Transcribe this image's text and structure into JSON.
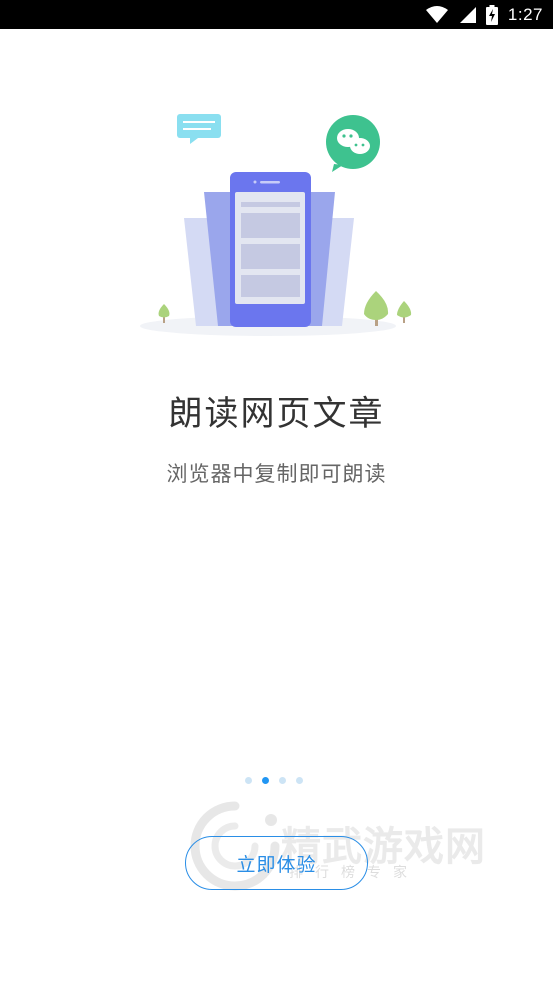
{
  "status_bar": {
    "time": "1:27",
    "icons": [
      "wifi-icon",
      "cell-signal-icon",
      "battery-charging-icon"
    ]
  },
  "onboarding": {
    "title": "朗读网页文章",
    "subtitle": "浏览器中复制即可朗读",
    "page_indicator": {
      "total": 4,
      "active_index": 1
    },
    "cta_label": "立即体验"
  },
  "illustration": {
    "icons": [
      "chat-bubble-icon",
      "wechat-icon",
      "phone-icon",
      "tree-icon"
    ]
  },
  "watermark": {
    "brand": "精武游戏网",
    "tagline": "排行榜专家"
  },
  "colors": {
    "accent": "#2a8ee6",
    "active_dot": "#2196f3",
    "inactive_dot": "#cde4f5",
    "phone": "#6b76ee",
    "wechat": "#3ec28f"
  }
}
